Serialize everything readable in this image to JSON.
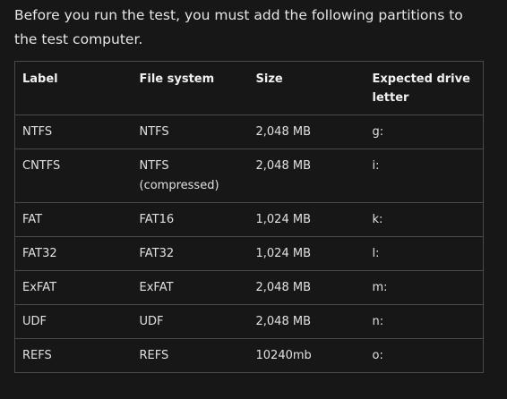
{
  "intro": "Before you run the test, you must add the following partitions to the test computer.",
  "table": {
    "headers": [
      "Label",
      "File system",
      "Size",
      "Expected drive letter"
    ],
    "rows": [
      [
        "NTFS",
        "NTFS",
        "2,048 MB",
        "g:"
      ],
      [
        "CNTFS",
        "NTFS (compressed)",
        "2,048 MB",
        "i:"
      ],
      [
        "FAT",
        "FAT16",
        "1,024 MB",
        "k:"
      ],
      [
        "FAT32",
        "FAT32",
        "1,024 MB",
        "l:"
      ],
      [
        "ExFAT",
        "ExFAT",
        "2,048 MB",
        "m:"
      ],
      [
        "UDF",
        "UDF",
        "2,048 MB",
        "n:"
      ],
      [
        "REFS",
        "REFS",
        "10240mb",
        "o:"
      ]
    ]
  }
}
